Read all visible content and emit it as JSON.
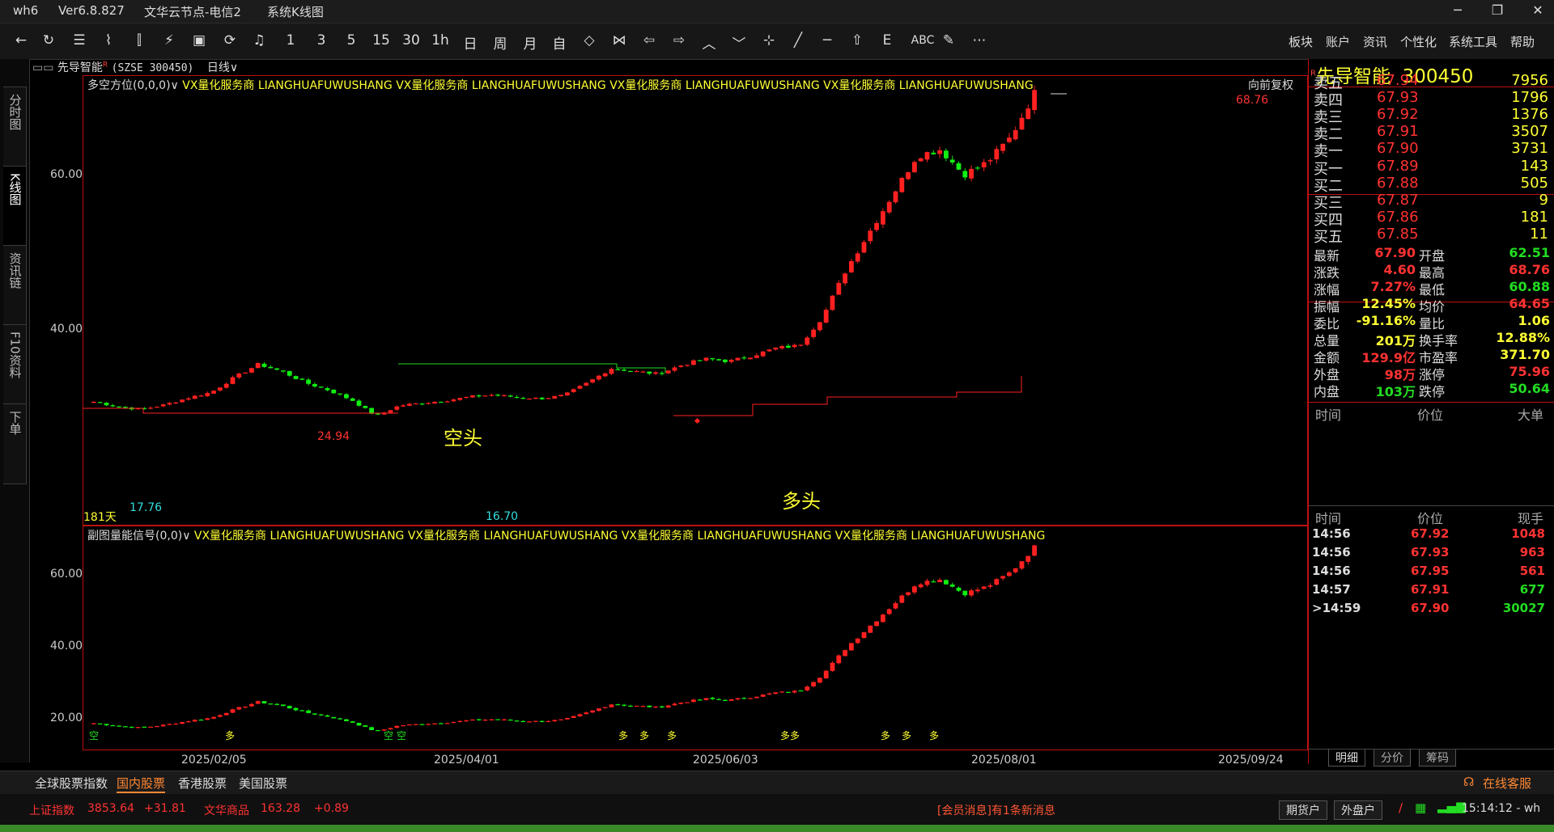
{
  "window": {
    "app": "wh6",
    "version": "Ver6.8.827",
    "node": "文华云节点-电信2",
    "view": "系统K线图",
    "min": "─",
    "max": "❐",
    "close": "✕"
  },
  "toolbar": {
    "icons": [
      "back-icon",
      "refresh-icon",
      "list-icon",
      "line-icon",
      "candle-icon",
      "tool-icon",
      "board-icon",
      "sync-icon",
      "bell-icon"
    ],
    "periods": [
      "1",
      "3",
      "5",
      "15",
      "30",
      "1h",
      "日",
      "周",
      "月",
      "自"
    ],
    "menu": [
      "板块",
      "账户",
      "资讯",
      "个性化",
      "系统工具",
      "帮助"
    ]
  },
  "left_tabs": [
    "分时图",
    "K线图",
    "资讯链",
    "F10资料",
    "下单"
  ],
  "stock": {
    "name": "先导智能",
    "superscript": "R",
    "exchange_code": "(SZSE 300450)",
    "period": "日线",
    "period_caret": "∨"
  },
  "main_chart": {
    "indicator": "多空方位(0,0,0)∨",
    "ad_pairs": [
      "VX量化服务商",
      "LIANGHUAFUWUSHANG",
      "VX量化服务商",
      "LIANGHUAFUWUSHANG",
      "VX量化服务商",
      "LIANGHUAFUWUSHANG",
      "VX量化服务商",
      "LIANGHUAFUWUSHANG"
    ],
    "adjust": "向前复权",
    "y_ticks": [
      "60.00",
      "40.00"
    ],
    "labels": {
      "high_value": "68.76",
      "peak_left": "24.94",
      "low_left": "17.76",
      "low_mid": "16.70",
      "days": "181天",
      "short_label": "空头",
      "long_label": "多头"
    }
  },
  "sub_chart": {
    "indicator": "副图量能信号(0,0)∨",
    "ad_pairs": [
      "VX量化服务商",
      "LIANGHUAFUWUSHANG",
      "VX量化服务商",
      "LIANGHUAFUWUSHANG",
      "VX量化服务商",
      "LIANGHUAFUWUSHANG",
      "VX量化服务商",
      "LIANGHUAFUWUSHANG"
    ],
    "y_ticks": [
      "60.00",
      "40.00",
      "20.00"
    ],
    "signals": [
      "空",
      "多",
      "空",
      "空",
      "多",
      "多",
      "多",
      "多多",
      "多",
      "多",
      "多"
    ]
  },
  "x_axis": [
    "2025/02/05",
    "2025/04/01",
    "2025/06/03",
    "2025/08/01",
    "2025/09/24"
  ],
  "chart_data": {
    "type": "candlestick",
    "title": "",
    "xlabel": "",
    "ylabel": "",
    "x": [
      "2025/02/05",
      "2025/04/01",
      "2025/06/03",
      "2025/08/01",
      "2025/09/24"
    ],
    "ylim": [
      15,
      72
    ],
    "series": [
      {
        "name": "",
        "values": [
          19.0,
          18.2,
          17.76,
          18.5,
          19.6,
          20.5,
          22.9,
          24.94,
          23.8,
          22.0,
          20.8,
          19.2,
          16.7,
          18.4,
          18.8,
          19.2,
          19.8,
          20.1,
          19.7,
          19.5,
          20.0,
          22.0,
          24.3,
          23.8,
          23.4,
          24.8,
          25.8,
          25.4,
          26.3,
          27.5,
          27.9,
          32.5,
          40.0,
          46.0,
          52.0,
          58.0,
          59.0,
          55.0,
          57.0,
          61.0,
          67.9
        ]
      }
    ],
    "key_levels": {
      "high": 68.76,
      "low": 16.7,
      "left_low": 17.76,
      "left_peak": 24.94
    }
  },
  "quote": {
    "name": "先导智能",
    "code": "300450",
    "superscript": "R",
    "asks": [
      {
        "label": "卖五",
        "price": "67.94",
        "vol": "7956"
      },
      {
        "label": "卖四",
        "price": "67.93",
        "vol": "1796"
      },
      {
        "label": "卖三",
        "price": "67.92",
        "vol": "1376"
      },
      {
        "label": "卖二",
        "price": "67.91",
        "vol": "3507"
      },
      {
        "label": "卖一",
        "price": "67.90",
        "vol": "3731"
      }
    ],
    "bids": [
      {
        "label": "买一",
        "price": "67.89",
        "vol": "143"
      },
      {
        "label": "买二",
        "price": "67.88",
        "vol": "505"
      },
      {
        "label": "买三",
        "price": "67.87",
        "vol": "9"
      },
      {
        "label": "买四",
        "price": "67.86",
        "vol": "181"
      },
      {
        "label": "买五",
        "price": "67.85",
        "vol": "11"
      }
    ],
    "stats": [
      {
        "l1": "最新",
        "v1": "67.90",
        "c1": "red",
        "l2": "开盘",
        "v2": "62.51",
        "c2": "green"
      },
      {
        "l1": "涨跌",
        "v1": "4.60",
        "c1": "red",
        "l2": "最高",
        "v2": "68.76",
        "c2": "red"
      },
      {
        "l1": "涨幅",
        "v1": "7.27%",
        "c1": "red",
        "l2": "最低",
        "v2": "60.88",
        "c2": "green"
      },
      {
        "l1": "振幅",
        "v1": "12.45%",
        "c1": "yellow",
        "l2": "均价",
        "v2": "64.65",
        "c2": "red"
      },
      {
        "l1": "委比",
        "v1": "-91.16%",
        "c1": "yellow",
        "l2": "量比",
        "v2": "1.06",
        "c2": "yellow"
      },
      {
        "l1": "总量",
        "v1": "201万",
        "c1": "yellow",
        "l2": "换手率",
        "v2": "12.88%",
        "c2": "yellow"
      },
      {
        "l1": "金额",
        "v1": "129.9亿",
        "c1": "red",
        "l2": "市盈率",
        "v2": "371.70",
        "c2": "yellow"
      },
      {
        "l1": "外盘",
        "v1": "98万",
        "c1": "red",
        "l2": "涨停",
        "v2": "75.96",
        "c2": "red"
      },
      {
        "l1": "内盘",
        "v1": "103万",
        "c1": "green",
        "l2": "跌停",
        "v2": "50.64",
        "c2": "green"
      }
    ],
    "big_header": [
      "时间",
      "价位",
      "大单"
    ],
    "tick_header": [
      "时间",
      "价位",
      "现手"
    ],
    "ticks": [
      {
        "time": "14:56",
        "price": "67.92",
        "vol": "1048",
        "vc": "red"
      },
      {
        "time": "14:56",
        "price": "67.93",
        "vol": "963",
        "vc": "red"
      },
      {
        "time": "14:56",
        "price": "67.95",
        "vol": "561",
        "vc": "red"
      },
      {
        "time": "14:57",
        "price": "67.91",
        "vol": "677",
        "vc": "green"
      },
      {
        "time": ">14:59",
        "price": "67.90",
        "vol": "30027",
        "vc": "green"
      }
    ],
    "panel_tabs": [
      "明细",
      "分价",
      "筹码"
    ]
  },
  "bottom_tabs": [
    "全球股票指数",
    "国内股票",
    "香港股票",
    "美国股票"
  ],
  "service": "在线客服",
  "status": {
    "index1_name": "上证指数",
    "index1_val": "3853.64",
    "index1_chg": "+31.81",
    "index2_name": "文华商品",
    "index2_val": "163.28",
    "index2_chg": "+0.89",
    "message": "[会员消息]有1条新消息",
    "btn1": "期货户",
    "btn2": "外盘户",
    "time": "15:14:12 - wh"
  },
  "colors": {
    "up": "#ff3232",
    "down": "#22dd22",
    "accent": "#ffff33",
    "border": "#b11111"
  }
}
